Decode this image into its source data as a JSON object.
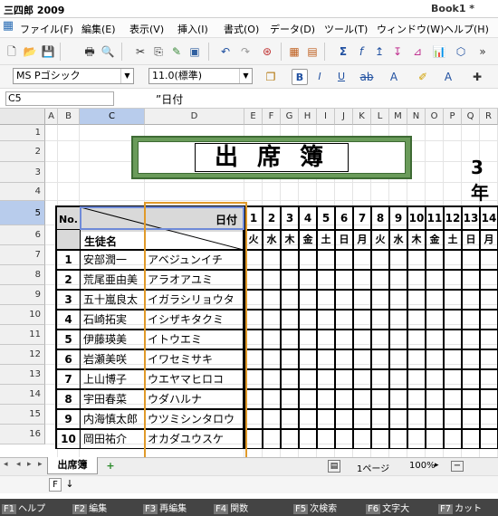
{
  "app": {
    "title": "三四郎 2009",
    "document": "Book1 *"
  },
  "menus": [
    "ファイル(F)",
    "編集(E)",
    "表示(V)",
    "挿入(I)",
    "書式(O)",
    "データ(D)",
    "ツール(T)",
    "ウィンドウ(W)",
    "ヘルプ(H)"
  ],
  "toolbar2": {
    "font": "MS Pゴシック",
    "size": "11.0(標準)"
  },
  "formula": {
    "cell": "C5",
    "content": "”日付"
  },
  "columns": [
    "A",
    "B",
    "C",
    "D",
    "E",
    "F",
    "G",
    "H",
    "I",
    "J",
    "K",
    "L",
    "M",
    "N",
    "O",
    "P",
    "Q",
    "R"
  ],
  "rows": [
    "1",
    "2",
    "3",
    "4",
    "5",
    "6",
    "7",
    "8",
    "9",
    "10",
    "11",
    "12",
    "13",
    "14",
    "15",
    "16"
  ],
  "sheet": {
    "title": "出 席 簿",
    "grade": "3年",
    "no_label": "No.",
    "date_label": "日付",
    "name_label": "生徒名",
    "days": [
      "1",
      "2",
      "3",
      "4",
      "5",
      "6",
      "7",
      "8",
      "9",
      "10",
      "11",
      "12",
      "13",
      "14"
    ],
    "weekdays": [
      "火",
      "水",
      "木",
      "金",
      "土",
      "日",
      "月",
      "火",
      "水",
      "木",
      "金",
      "土",
      "日",
      "月"
    ],
    "students": [
      {
        "no": "1",
        "name": "安部潤一",
        "kana": "アベジュンイチ"
      },
      {
        "no": "2",
        "name": "荒尾亜由美",
        "kana": "アラオアユミ"
      },
      {
        "no": "3",
        "name": "五十嵐良太",
        "kana": "イガラシリョウタ"
      },
      {
        "no": "4",
        "name": "石崎拓実",
        "kana": "イシザキタクミ"
      },
      {
        "no": "5",
        "name": "伊藤瑛美",
        "kana": "イトウエミ"
      },
      {
        "no": "6",
        "name": "岩瀬美咲",
        "kana": "イワセミサキ"
      },
      {
        "no": "7",
        "name": "上山博子",
        "kana": "ウエヤマヒロコ"
      },
      {
        "no": "8",
        "name": "宇田春菜",
        "kana": "ウダハルナ"
      },
      {
        "no": "9",
        "name": "内海慎太郎",
        "kana": "ウツミシンタロウ"
      },
      {
        "no": "10",
        "name": "岡田祐介",
        "kana": "オカダユウスケ"
      }
    ]
  },
  "tabs": {
    "sheet": "出席簿",
    "add": "+"
  },
  "status": {
    "page": "1ページ",
    "zoom": "100%",
    "mode_f": "F",
    "mode_arrow": "↓"
  },
  "fkeys": [
    {
      "key": "F1",
      "label": "ヘルプ"
    },
    {
      "key": "F2",
      "label": "編集"
    },
    {
      "key": "F3",
      "label": "再編集"
    },
    {
      "key": "F4",
      "label": "関数"
    },
    {
      "key": "F5",
      "label": "次検索"
    },
    {
      "key": "F6",
      "label": "文字大"
    },
    {
      "key": "F7",
      "label": "カット"
    }
  ]
}
